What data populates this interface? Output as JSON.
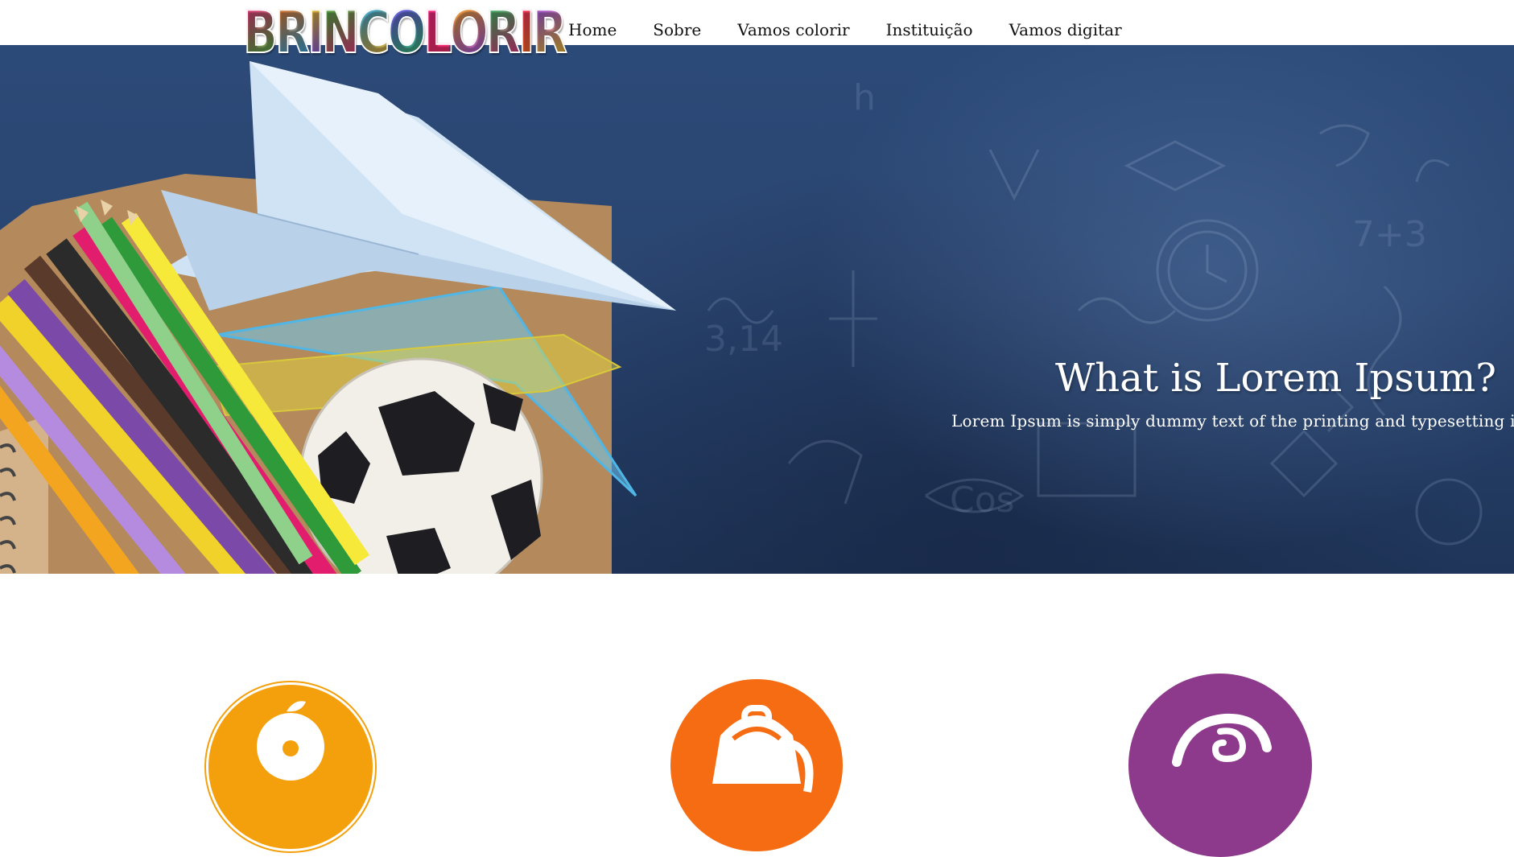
{
  "brand": {
    "logo_text": "BRINCOLORIR",
    "logo_colors": [
      "#ff2d8a",
      "#ff7a1a",
      "#ffd21a",
      "#3ec93e",
      "#22b0ff",
      "#7a4dff",
      "#ff2d8a",
      "#ffb11a",
      "#2fd06a",
      "#ff2d6e",
      "#a24dff"
    ]
  },
  "nav": {
    "items": [
      {
        "label": "Home"
      },
      {
        "label": "Sobre"
      },
      {
        "label": "Vamos colorir"
      },
      {
        "label": "Instituição"
      },
      {
        "label": "Vamos digitar"
      }
    ]
  },
  "hero": {
    "title": "What is Lorem Ipsum?",
    "subtitle": "Lorem Ipsum is simply dummy text of the printing and typesetting industry.",
    "image_objects": [
      "paper-airplane",
      "soccer-ball",
      "colored-pencils",
      "ruler-triangle",
      "notebook"
    ]
  },
  "features": [
    {
      "icon": "apple-icon",
      "color": "#f4a00c"
    },
    {
      "icon": "backpack-icon",
      "color": "#f56c12"
    },
    {
      "icon": "swirl-icon",
      "color": "#8e3a8c"
    }
  ]
}
